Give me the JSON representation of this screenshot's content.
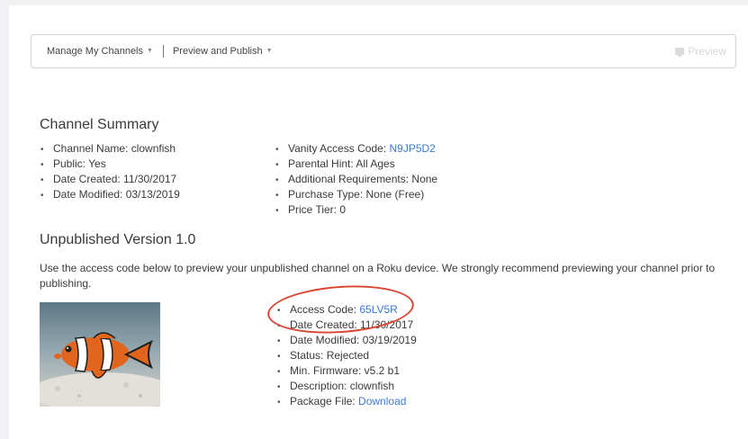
{
  "toolbar": {
    "manage_label": "Manage My Channels",
    "publish_label": "Preview and Publish",
    "preview_label": "Preview",
    "icons": {
      "chevron": "chevron-down-icon",
      "preview": "monitor-icon"
    }
  },
  "summary": {
    "title": "Channel Summary",
    "left": [
      "Channel Name: clownfish",
      "Public: Yes",
      "Date Created: 11/30/2017",
      "Date Modified: 03/13/2019"
    ],
    "vanity_label": "Vanity Access Code: ",
    "vanity_code": "N9JP5D2",
    "right": [
      "Parental Hint: All Ages",
      "Additional Requirements: None",
      "Purchase Type: None (Free)",
      "Price Tier: 0"
    ]
  },
  "version": {
    "title": "Unpublished Version 1.0",
    "description": "Use the access code below to preview your unpublished channel on a Roku device. We strongly recommend previewing your channel prior to publishing.",
    "access_label": "Access Code: ",
    "access_code": "65LV5R",
    "details": [
      "Date Created: 11/30/2017",
      "Date Modified: 03/19/2019",
      "Status: Rejected",
      "Min. Firmware: v5.2 b1",
      "Description: clownfish"
    ],
    "package_label": "Package File: ",
    "package_link": "Download"
  },
  "colors": {
    "link": "#3a7bd5",
    "annotation": "#d9452e",
    "page_bg": "#f1f1f3"
  }
}
